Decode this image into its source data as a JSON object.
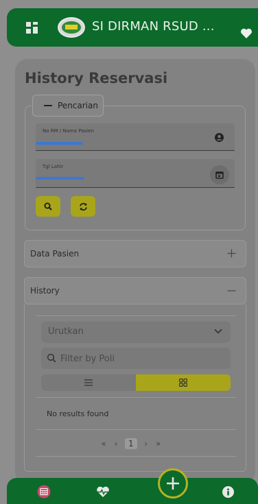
{
  "header": {
    "title": "SI DIRMAN RSUD ..."
  },
  "page": {
    "title": "History Reservasi"
  },
  "search": {
    "legend": "Pencarian",
    "rm_label": "No RM / Nama Pasien",
    "dob_label": "Tgl Lahir"
  },
  "accordions": {
    "data_pasien": "Data Pasien",
    "history": "History"
  },
  "history": {
    "sort_value": "Urutkan",
    "filter_placeholder": "Filter by Poli",
    "no_results": "No results found"
  },
  "pagination": {
    "first": "«",
    "prev": "‹",
    "current": "1",
    "next": "›",
    "last": "»"
  },
  "colors": {
    "primary_green": "#0c6a2a",
    "accent_yellow": "#a8a51a"
  },
  "icons": {
    "menu": "grid-icon",
    "favorite": "heart-icon",
    "user": "user-circle-icon",
    "date": "calendar-icon",
    "search": "search-icon",
    "refresh": "refresh-icon",
    "expand": "plus-icon",
    "collapse": "minus-icon",
    "dropdown": "chevron-down-icon",
    "list_view": "list-icon",
    "grid_view": "grid-view-icon",
    "nav_schedule": "calendar-icon",
    "nav_health": "heart-pulse-icon",
    "nav_add": "add-icon",
    "nav_info": "info-icon"
  }
}
